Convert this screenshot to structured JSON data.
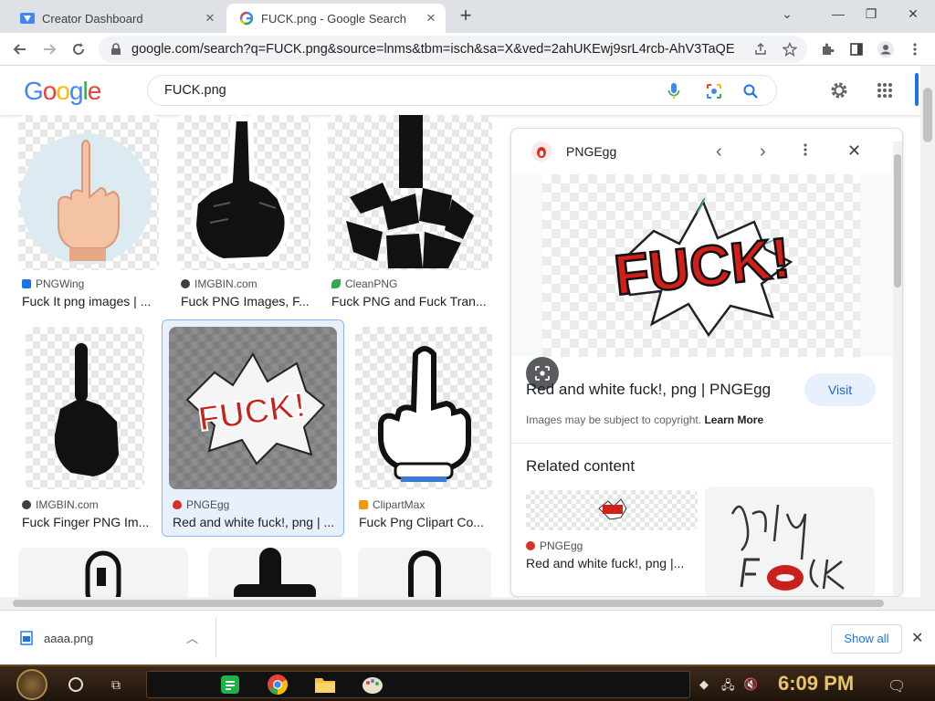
{
  "tabs": [
    {
      "title": "Creator Dashboard",
      "active": false
    },
    {
      "title": "FUCK.png - Google Search",
      "active": true
    }
  ],
  "window_controls": {
    "minimize": "⌄",
    "restore": "❐",
    "close": "✕"
  },
  "address": {
    "url": "google.com/search?q=FUCK.png&source=lnms&tbm=isch&sa=X&ved=2ahUKEwj9srL4rcb-AhV3TaQEH..."
  },
  "search": {
    "query": "FUCK.png",
    "logo": "Google"
  },
  "results": [
    {
      "source": "PNGWing",
      "title": "Fuck It png images | ...",
      "src_color": "#1a73e8"
    },
    {
      "source": "IMGBIN.com",
      "title": "Fuck PNG Images, F...",
      "src_color": "#3c4043"
    },
    {
      "source": "CleanPNG",
      "title": "Fuck PNG and Fuck Tran...",
      "src_color": "#34a853"
    },
    {
      "source": "IMGBIN.com",
      "title": "Fuck Finger PNG Im...",
      "src_color": "#3c4043"
    },
    {
      "source": "PNGEgg",
      "title": "Red and white fuck!, png | ...",
      "src_color": "#d93025"
    },
    {
      "source": "ClipartMax",
      "title": "Fuck Png Clipart Co...",
      "src_color": "#f29900"
    }
  ],
  "panel": {
    "source": "PNGEgg",
    "image_text": "FUCK!",
    "title": "Red and white fuck!, png | PNGEgg",
    "visit_label": "Visit",
    "copyright": "Images may be subject to copyright.",
    "learn_more": "Learn More",
    "related_heading": "Related content",
    "related_source": "PNGEgg",
    "related_title": "Red and white fuck!, png |..."
  },
  "downloads": {
    "file": "aaaa.png",
    "show_all": "Show all"
  },
  "taskbar": {
    "time": "6:09 PM"
  }
}
